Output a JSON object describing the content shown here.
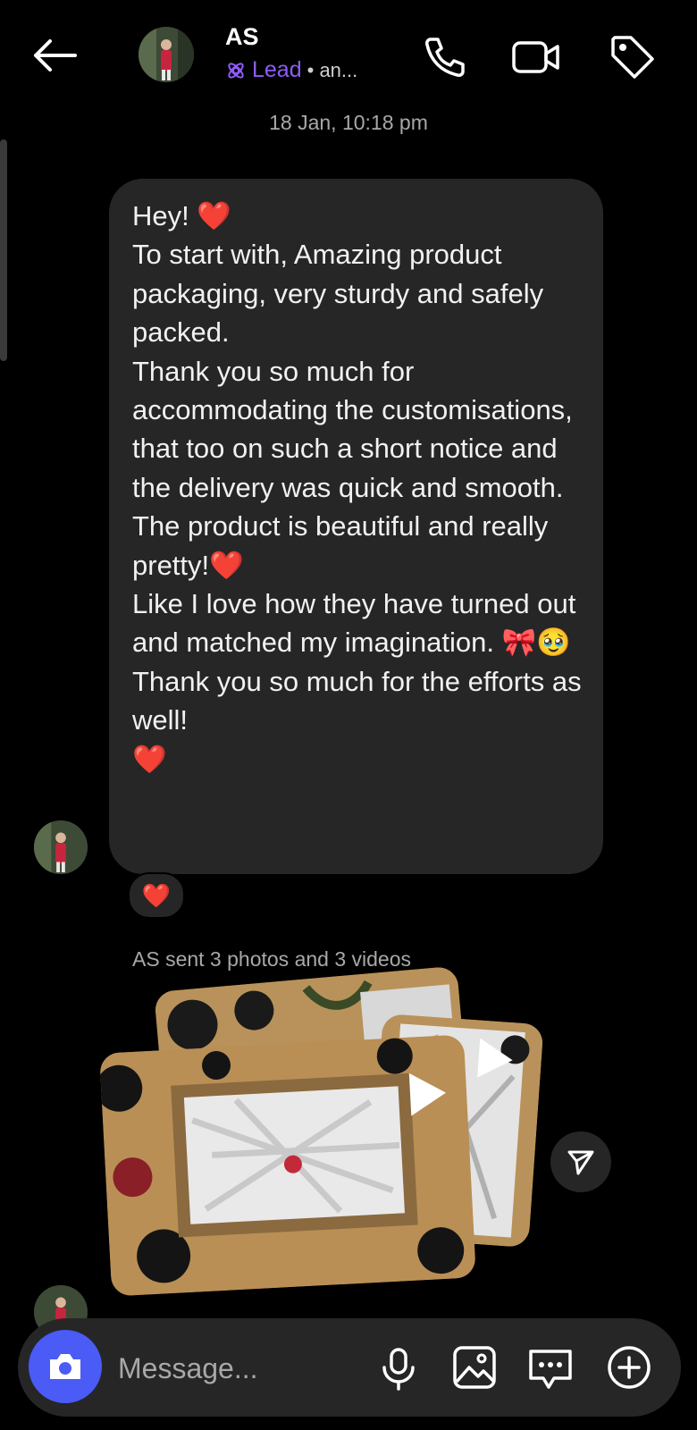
{
  "header": {
    "contact_name": "AS",
    "label": "Lead",
    "label_suffix": "• an...",
    "icons": [
      "back-arrow-icon",
      "phone-icon",
      "video-call-icon",
      "tag-icon"
    ]
  },
  "timestamp": "18 Jan, 10:18 pm",
  "message": {
    "text": "Hey! ❤️\nTo start with, Amazing product packaging, very sturdy and safely packed.\nThank you so much for accommodating the customisations, that too on such a short notice and the delivery was quick and smooth.\nThe product is beautiful and really pretty!❤️\nLike I love how they have turned out and matched my imagination. 🎀🥹 Thank you so much for the efforts as well!\n❤️",
    "reaction": "❤️"
  },
  "media_note": "AS sent 3 photos and 3 videos",
  "composer": {
    "placeholder": "Message...",
    "icons": [
      "camera-icon",
      "microphone-icon",
      "gallery-icon",
      "sticker-icon",
      "add-icon"
    ]
  },
  "colors": {
    "background": "#000000",
    "bubble": "#262626",
    "accent_purple": "#8f5cf7",
    "camera_button": "#4a5bf6",
    "muted_text": "#a8a8a8"
  }
}
